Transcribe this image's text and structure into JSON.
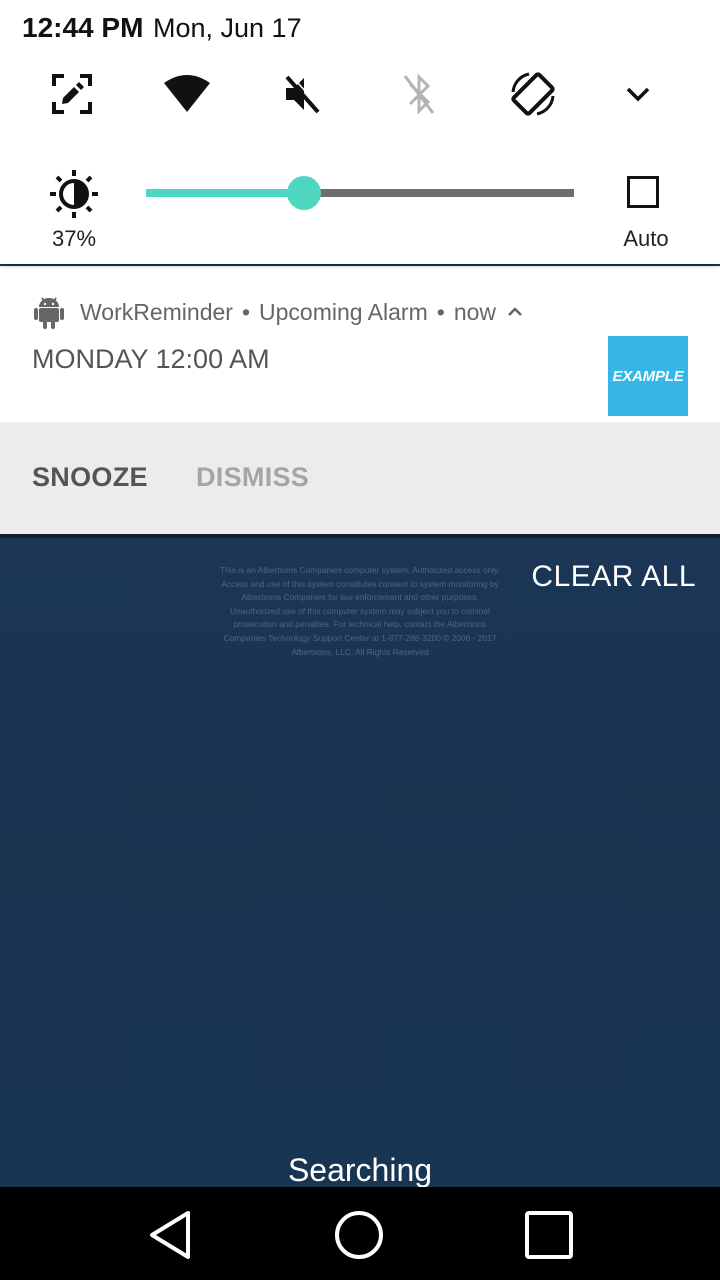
{
  "status_bar": {
    "time": "12:44 PM",
    "date": "Mon, Jun 17"
  },
  "quick_settings": {
    "tiles": [
      "screen-cast-icon",
      "wifi-icon",
      "mute-icon",
      "bluetooth-off-icon",
      "auto-rotate-icon",
      "expand-chevron-icon"
    ],
    "brightness": {
      "percent_label": "37%",
      "level": 0.37,
      "auto_label": "Auto"
    },
    "accent_color": "#4fd6c0"
  },
  "notification": {
    "app_name": "WorkReminder",
    "subtext": "Upcoming Alarm",
    "time": "now",
    "title": "MONDAY 12:00 AM",
    "thumbnail_text": "EXAMPLE",
    "thumbnail_color": "#35b6e6",
    "actions": {
      "snooze": "SNOOZE",
      "dismiss": "DISMISS"
    }
  },
  "background_app": {
    "clear_all_label": "CLEAR ALL",
    "disclaimer": "This is an Albertsons Companies computer system. Authorized access only. Access and use of this system constitutes consent to system monitoring by Albertsons Companies for law enforcement and other purposes. Unauthorized use of this computer system may subject you to criminal prosecution and penalties. For technical help, contact the Albertsons Companies Technology Support Center at 1-877-286-3200 © 2006 - 2017 Albertsons, LLC. All Rights Reserved",
    "status_text": "Searching"
  },
  "nav_bar": {
    "buttons": [
      "back-icon",
      "home-icon",
      "recents-icon"
    ]
  }
}
